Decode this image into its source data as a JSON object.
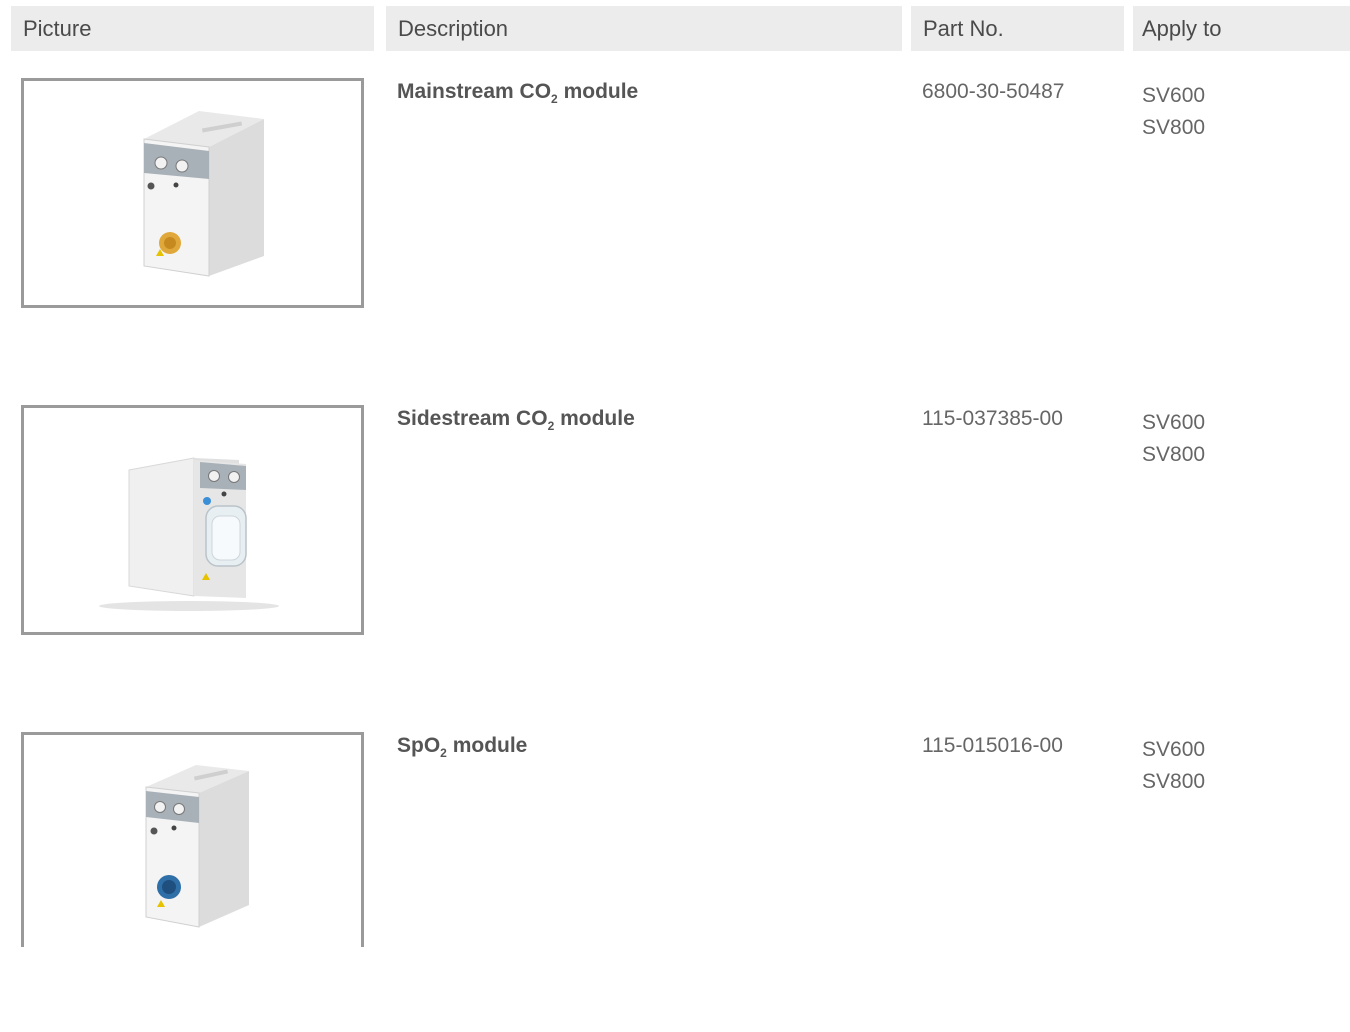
{
  "headers": {
    "picture": "Picture",
    "description": "Description",
    "part_no": "Part No.",
    "apply_to": "Apply to"
  },
  "rows": [
    {
      "desc_pre": "Mainstream CO",
      "desc_sub": "2",
      "desc_post": " module",
      "part_no": "6800-30-50487",
      "apply": [
        "SV600",
        "SV800"
      ],
      "image": "mainstream-co2-module-photo",
      "connector_color": "#e0a83a"
    },
    {
      "desc_pre": "Sidestream CO",
      "desc_sub": "2",
      "desc_post": " module",
      "part_no": "115-037385-00",
      "apply": [
        "SV600",
        "SV800"
      ],
      "image": "sidestream-co2-module-photo"
    },
    {
      "desc_pre": "SpO",
      "desc_sub": "2",
      "desc_post": " module",
      "part_no": "115-015016-00",
      "apply": [
        "SV600",
        "SV800"
      ],
      "image": "spo2-module-photo",
      "connector_color": "#2f6fa8"
    }
  ]
}
